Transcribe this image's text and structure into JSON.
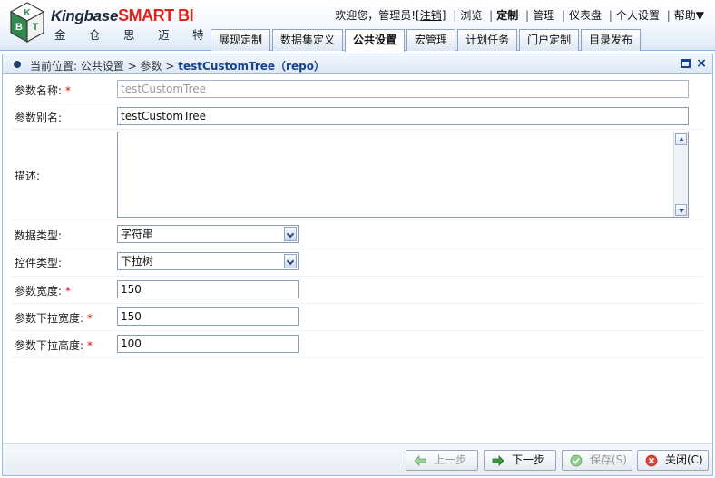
{
  "brand": {
    "name_latin": "Kingbase",
    "name_suffix": "SMART BI",
    "name_cn": [
      "金",
      "仓",
      "思",
      "迈",
      "特"
    ],
    "logo_letters": [
      "K",
      "B",
      "T"
    ]
  },
  "topmenu": {
    "welcome": "欢迎您，管理员!",
    "logout": "注销",
    "items": [
      "浏览",
      "定制",
      "管理",
      "仪表盘",
      "个人设置",
      "帮助▼"
    ]
  },
  "tabs": [
    "展现定制",
    "数据集定义",
    "公共设置",
    "宏管理",
    "计划任务",
    "门户定制",
    "目录发布"
  ],
  "active_tab": "公共设置",
  "breadcrumb": {
    "prefix": "当前位置:",
    "path": "公共设置 > 参数 >",
    "current": "testCustomTree（repo）"
  },
  "form": {
    "param_name": {
      "label": "参数名称:",
      "required": "*",
      "value": "testCustomTree"
    },
    "param_alias": {
      "label": "参数别名:",
      "value": "testCustomTree"
    },
    "description": {
      "label": "描述:",
      "value": ""
    },
    "data_type": {
      "label": "数据类型:",
      "value": "字符串"
    },
    "control_type": {
      "label": "控件类型:",
      "value": "下拉树"
    },
    "param_width": {
      "label": "参数宽度:",
      "required": "*",
      "value": "150"
    },
    "dropdown_width": {
      "label": "参数下拉宽度:",
      "required": "*",
      "value": "150"
    },
    "dropdown_height": {
      "label": "参数下拉高度:",
      "required": "*",
      "value": "100"
    }
  },
  "buttons": {
    "prev": "上一步",
    "next": "下一步",
    "save": "保存(S)",
    "close": "关闭(C)"
  },
  "colors": {
    "accent": "#15428b",
    "brand_red": "#e2231a",
    "required": "#ee0000",
    "panel_border": "#99bbe8"
  }
}
